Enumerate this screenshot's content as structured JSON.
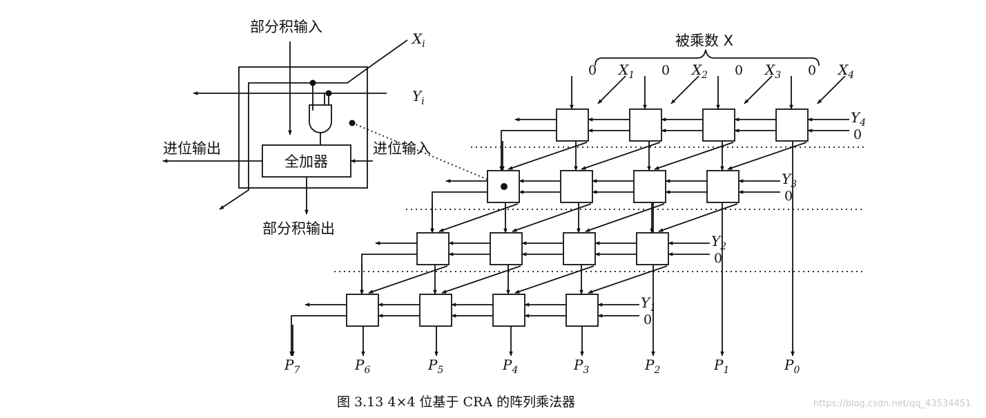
{
  "cell": {
    "partial_in": "部分积输入",
    "partial_out": "部分积输出",
    "carry_in": "进位输入",
    "carry_out": "进位输出",
    "adder": "全加器",
    "x_label": "X",
    "x_sub": "i",
    "y_label": "Y",
    "y_sub": "i"
  },
  "array": {
    "multiplicand": "被乘数 X",
    "zero": "0",
    "x_inputs": [
      {
        "label": "X",
        "sub": "1"
      },
      {
        "label": "X",
        "sub": "2"
      },
      {
        "label": "X",
        "sub": "3"
      },
      {
        "label": "X",
        "sub": "4"
      }
    ],
    "y_inputs": [
      {
        "label": "Y",
        "sub": "4"
      },
      {
        "label": "Y",
        "sub": "3"
      },
      {
        "label": "Y",
        "sub": "2"
      },
      {
        "label": "Y",
        "sub": "1"
      }
    ],
    "outputs": [
      {
        "label": "P",
        "sub": "7"
      },
      {
        "label": "P",
        "sub": "6"
      },
      {
        "label": "P",
        "sub": "5"
      },
      {
        "label": "P",
        "sub": "4"
      },
      {
        "label": "P",
        "sub": "3"
      },
      {
        "label": "P",
        "sub": "2"
      },
      {
        "label": "P",
        "sub": "1"
      },
      {
        "label": "P",
        "sub": "0"
      }
    ]
  },
  "caption": "图 3.13   4×4 位基于 CRA 的阵列乘法器",
  "watermark": "https://blog.csdn.net/qq_43534451"
}
